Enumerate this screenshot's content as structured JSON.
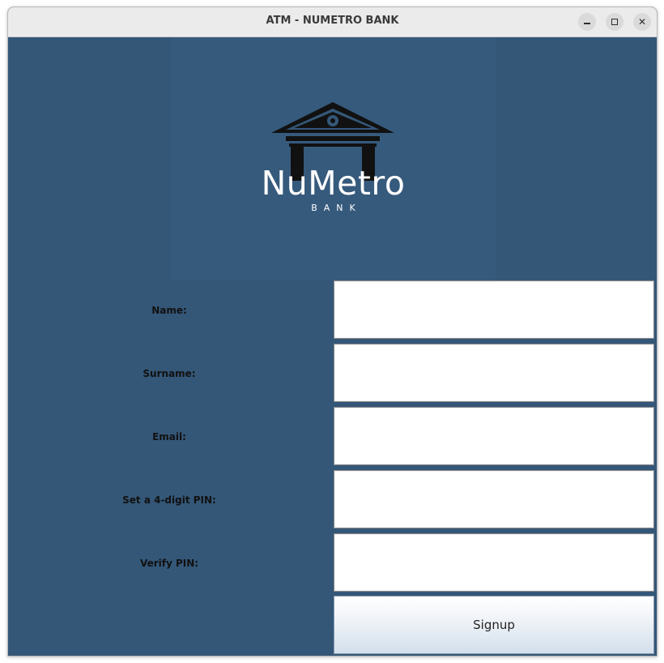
{
  "window": {
    "title": "ATM - NUMETRO BANK",
    "controls": {
      "minimize": "minimize-icon",
      "maximize": "maximize-icon",
      "close": "close-icon"
    }
  },
  "logo": {
    "icon": "bank-building-icon",
    "name": "NuMetro",
    "subtitle": "BANK"
  },
  "form": {
    "fields": [
      {
        "label": "Name:",
        "value": "",
        "placeholder": ""
      },
      {
        "label": "Surname:",
        "value": "",
        "placeholder": ""
      },
      {
        "label": "Email:",
        "value": "",
        "placeholder": ""
      },
      {
        "label": "Set a 4-digit PIN:",
        "value": "",
        "placeholder": ""
      },
      {
        "label": "Verify PIN:",
        "value": "",
        "placeholder": ""
      }
    ],
    "submit_label": "Signup"
  },
  "colors": {
    "background": "#345778",
    "titlebar": "#ebebeb",
    "label_text": "#111111"
  }
}
